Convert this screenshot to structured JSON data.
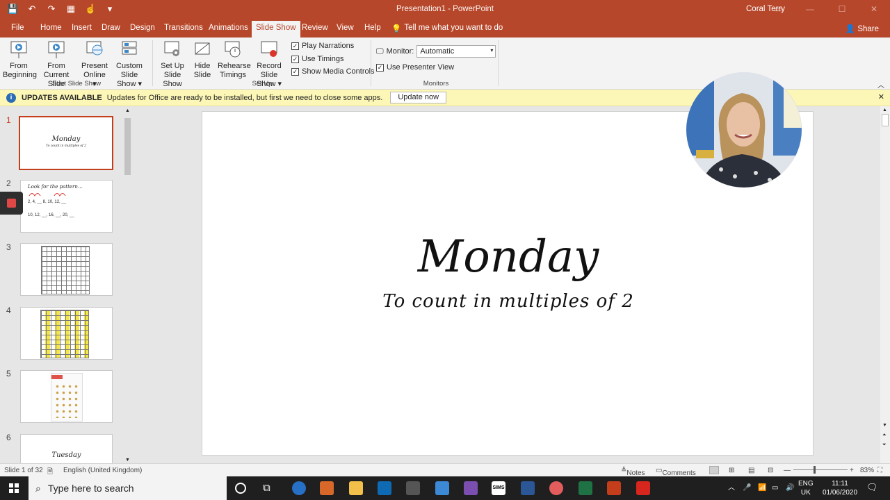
{
  "window": {
    "title": "Presentation1  -  PowerPoint",
    "user": "Coral Terry"
  },
  "tabs": [
    "File",
    "Home",
    "Insert",
    "Draw",
    "Design",
    "Transitions",
    "Animations",
    "Slide Show",
    "Review",
    "View",
    "Help"
  ],
  "active_tab": "Slide Show",
  "tellme": "Tell me what you want to do",
  "share": "Share",
  "ribbon": {
    "from_beginning": [
      "From",
      "Beginning"
    ],
    "from_current": [
      "From",
      "Current Slide"
    ],
    "present_online": [
      "Present",
      "Online ▾"
    ],
    "custom_show": [
      "Custom Slide",
      "Show ▾"
    ],
    "group_start": "Start Slide Show",
    "setup_show": [
      "Set Up",
      "Slide Show"
    ],
    "hide_slide": [
      "Hide",
      "Slide"
    ],
    "rehearse": [
      "Rehearse",
      "Timings"
    ],
    "record": [
      "Record Slide",
      "Show ▾"
    ],
    "play_narrations": "Play Narrations",
    "use_timings": "Use Timings",
    "show_media": "Show Media Controls",
    "group_setup": "Set Up",
    "monitor_label": "Monitor:",
    "monitor_value": "Automatic",
    "presenter_view": "Use Presenter View",
    "group_monitors": "Monitors"
  },
  "update_bar": {
    "title": "UPDATES AVAILABLE",
    "message": "Updates for Office are ready to be installed, but first we need to close some apps.",
    "button": "Update now"
  },
  "slides": {
    "numbers": [
      "1",
      "2",
      "3",
      "4",
      "5",
      "6"
    ],
    "s1_title": "Monday",
    "s1_sub": "To count in multiples of 2",
    "s2_title": "Look for the pattern…",
    "s2_line1": "2,  4,  __  8,  10,  12,  __",
    "s2_line2": "10,  12,  __,  16,  __,  20, __",
    "s6_title": "Tuesday"
  },
  "main_slide": {
    "title": "Monday",
    "subtitle": "To count in multiples of 2"
  },
  "status": {
    "slide": "Slide 1 of 32",
    "language": "English (United Kingdom)",
    "notes": "Notes",
    "comments": "Comments",
    "zoom": "83%"
  },
  "taskbar": {
    "search_placeholder": "Type here to search",
    "lang1": "ENG",
    "lang2": "UK",
    "time": "11:11",
    "date": "01/06/2020"
  }
}
